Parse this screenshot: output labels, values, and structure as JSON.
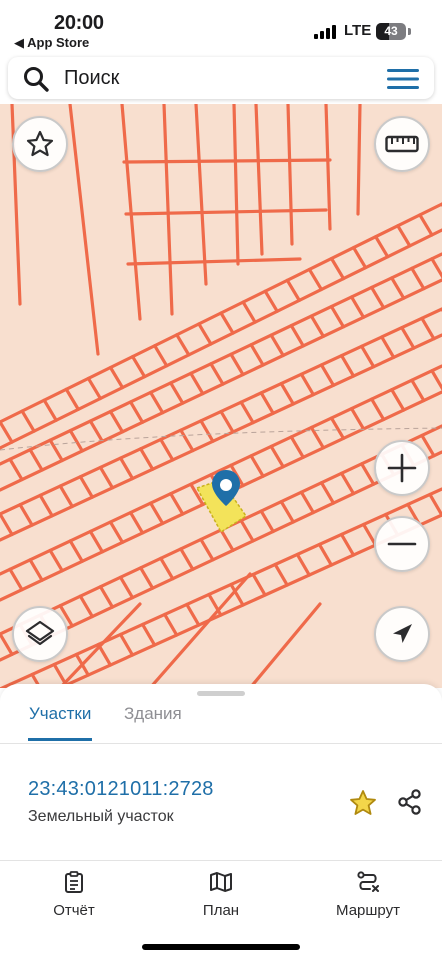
{
  "status_bar": {
    "time": "20:00",
    "back_label": "◀ App Store",
    "network": "LTE",
    "battery_level": "43"
  },
  "search": {
    "placeholder": "Поиск",
    "icon": "search-icon",
    "menu_icon": "hamburger-menu-icon"
  },
  "map": {
    "background_color": "#f8dfcf",
    "parcel_stroke_color": "#ef6a4a",
    "selected_parcel_color": "#f3e35a",
    "pin_color": "#1f6fa8",
    "controls": {
      "favorite": "star-icon",
      "ruler": "ruler-icon",
      "zoom_in": "plus-icon",
      "zoom_out": "minus-icon",
      "layers": "layers-icon",
      "locate": "location-arrow-icon"
    }
  },
  "sheet": {
    "tabs": [
      {
        "label": "Участки",
        "active": true
      },
      {
        "label": "Здания",
        "active": false
      }
    ],
    "result": {
      "cadastral_number": "23:43:0121011:2728",
      "type": "Земельный участок"
    }
  },
  "bottom_nav": [
    {
      "label": "Отчёт",
      "icon": "report-clipboard-icon"
    },
    {
      "label": "План",
      "icon": "map-plan-icon"
    },
    {
      "label": "Маршрут",
      "icon": "route-icon"
    }
  ],
  "accent_color": "#1f6fa8"
}
